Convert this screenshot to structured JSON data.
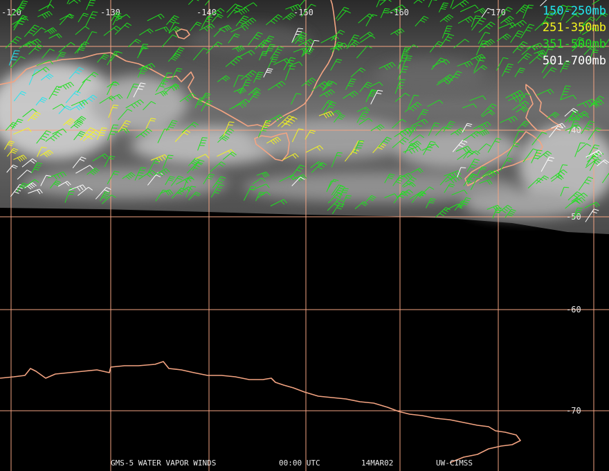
{
  "legend": {
    "levels": [
      {
        "label": "150-250mb",
        "color": "#22e6f0"
      },
      {
        "label": "251-350mb",
        "color": "#f5f51e"
      },
      {
        "label": "351-500mb",
        "color": "#1fe11f"
      },
      {
        "label": "501-700mb",
        "color": "#ffffff"
      }
    ]
  },
  "grid": {
    "longitude_labels": [
      "-120",
      "-130",
      "-140",
      "-150",
      "-160",
      "-170"
    ],
    "latitude_labels": [
      "-40",
      "-50",
      "-60",
      "-70"
    ],
    "line_color": "#f4a482"
  },
  "coastline_color": "#f4a482",
  "footer": {
    "product": "GMS-5 WATER VAPOR WINDS",
    "time": "00:00 UTC",
    "date": "14MAR02",
    "source": "UW-CIMSS"
  }
}
